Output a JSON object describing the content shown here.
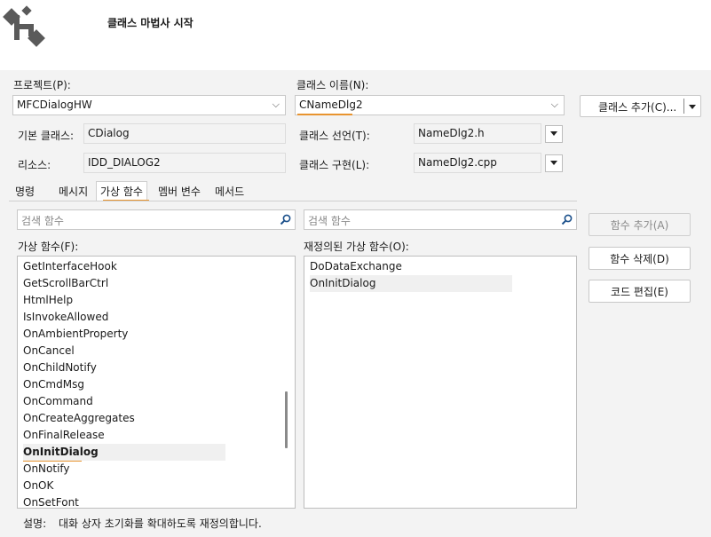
{
  "header": {
    "title": "클래스 마법사 시작"
  },
  "project": {
    "label": "프로젝트(P):",
    "value": "MFCDialogHW"
  },
  "classname": {
    "label": "클래스 이름(N):",
    "value": "CNameDlg2"
  },
  "add_class_button": "클래스 추가(C)...",
  "base_class": {
    "label": "기본 클래스:",
    "value": "CDialog"
  },
  "class_decl": {
    "label": "클래스 선언(T):",
    "value": "NameDlg2.h"
  },
  "resource": {
    "label": "리소스:",
    "value": "IDD_DIALOG2"
  },
  "class_impl": {
    "label": "클래스 구현(L):",
    "value": "NameDlg2.cpp"
  },
  "tabs": [
    "명령",
    "메시지",
    "가상 함수",
    "멤버 변수",
    "메서드"
  ],
  "search_left": {
    "placeholder": "검색 함수"
  },
  "search_right": {
    "placeholder": "검색 함수"
  },
  "virtual_label": "가상 함수(F):",
  "virtual_functions": [
    "GetInterfaceHook",
    "GetScrollBarCtrl",
    "HtmlHelp",
    "IsInvokeAllowed",
    "OnAmbientProperty",
    "OnCancel",
    "OnChildNotify",
    "OnCmdMsg",
    "OnCommand",
    "OnCreateAggregates",
    "OnFinalRelease",
    "OnInitDialog",
    "OnNotify",
    "OnOK",
    "OnSetFont"
  ],
  "selected_virtual": "OnInitDialog",
  "overridden_label": "재정의된 가상 함수(O):",
  "overridden_functions": [
    "DoDataExchange",
    "OnInitDialog"
  ],
  "buttons": {
    "add_function": "함수 추가(A)",
    "delete_function": "함수 삭제(D)",
    "edit_code": "코드 편집(E)"
  },
  "description": {
    "label": "설명:",
    "text": "대화 상자 초기화를 확대하도록 재정의합니다."
  },
  "colors": {
    "accent": "#e8942f",
    "logo": "#5a5a5a"
  }
}
